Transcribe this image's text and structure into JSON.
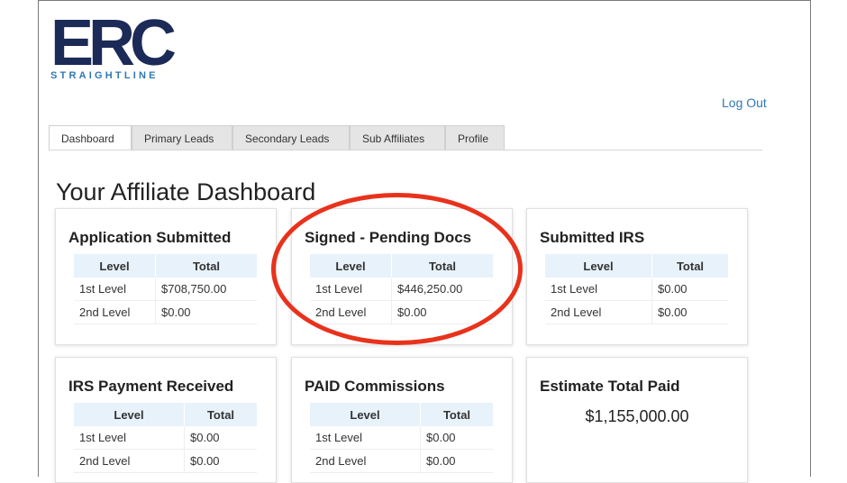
{
  "logo": {
    "text": "ERC",
    "subtitle": "STRAIGHTLINE",
    "color": "#1b2a57",
    "subtitle_color": "#2f78b7"
  },
  "header": {
    "logout_label": "Log Out"
  },
  "tabs": [
    {
      "label": "Dashboard",
      "active": true
    },
    {
      "label": "Primary Leads"
    },
    {
      "label": "Secondary Leads"
    },
    {
      "label": "Sub Affiliates"
    },
    {
      "label": "Profile"
    }
  ],
  "page_title": "Your Affiliate Dashboard",
  "table_headers": {
    "level": "Level",
    "total": "Total"
  },
  "cards": {
    "application_submitted": {
      "title": "Application Submitted",
      "rows": [
        {
          "level": "1st Level",
          "total": "$708,750.00"
        },
        {
          "level": "2nd Level",
          "total": "$0.00"
        }
      ]
    },
    "signed_pending": {
      "title": "Signed - Pending Docs",
      "rows": [
        {
          "level": "1st Level",
          "total": "$446,250.00"
        },
        {
          "level": "2nd Level",
          "total": "$0.00"
        }
      ]
    },
    "submitted_irs": {
      "title": "Submitted IRS",
      "rows": [
        {
          "level": "1st Level",
          "total": "$0.00"
        },
        {
          "level": "2nd Level",
          "total": "$0.00"
        }
      ]
    },
    "irs_payment": {
      "title": "IRS Payment Received",
      "rows": [
        {
          "level": "1st Level",
          "total": "$0.00"
        },
        {
          "level": "2nd Level",
          "total": "$0.00"
        }
      ]
    },
    "paid_commissions": {
      "title": "PAID Commissions",
      "rows": [
        {
          "level": "1st Level",
          "total": "$0.00"
        },
        {
          "level": "2nd Level",
          "total": "$0.00"
        }
      ]
    },
    "estimate_total": {
      "title": "Estimate Total Paid",
      "value": "$1,155,000.00"
    }
  },
  "annotation": {
    "color": "#e8321c"
  }
}
